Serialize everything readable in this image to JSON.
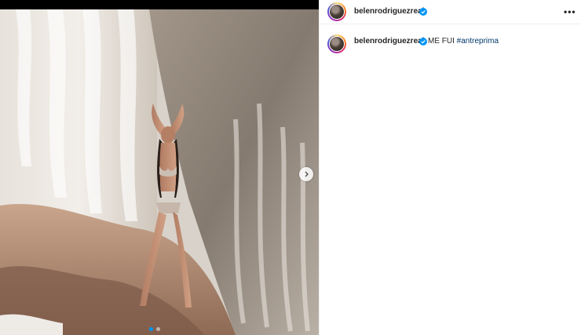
{
  "post": {
    "username": "belenrodriguezreal",
    "caption": {
      "text": "ME FUI",
      "hashtag": "#antreprima"
    },
    "more_label": "•••",
    "carousel": {
      "slides": 2,
      "active": 1
    }
  },
  "icons": {
    "verified": "verified-badge-icon",
    "next": "chevron-right-icon",
    "more": "more-options-icon"
  },
  "colors": {
    "verified": "#0095f6",
    "hashtag": "#00376b",
    "text": "#262626"
  }
}
